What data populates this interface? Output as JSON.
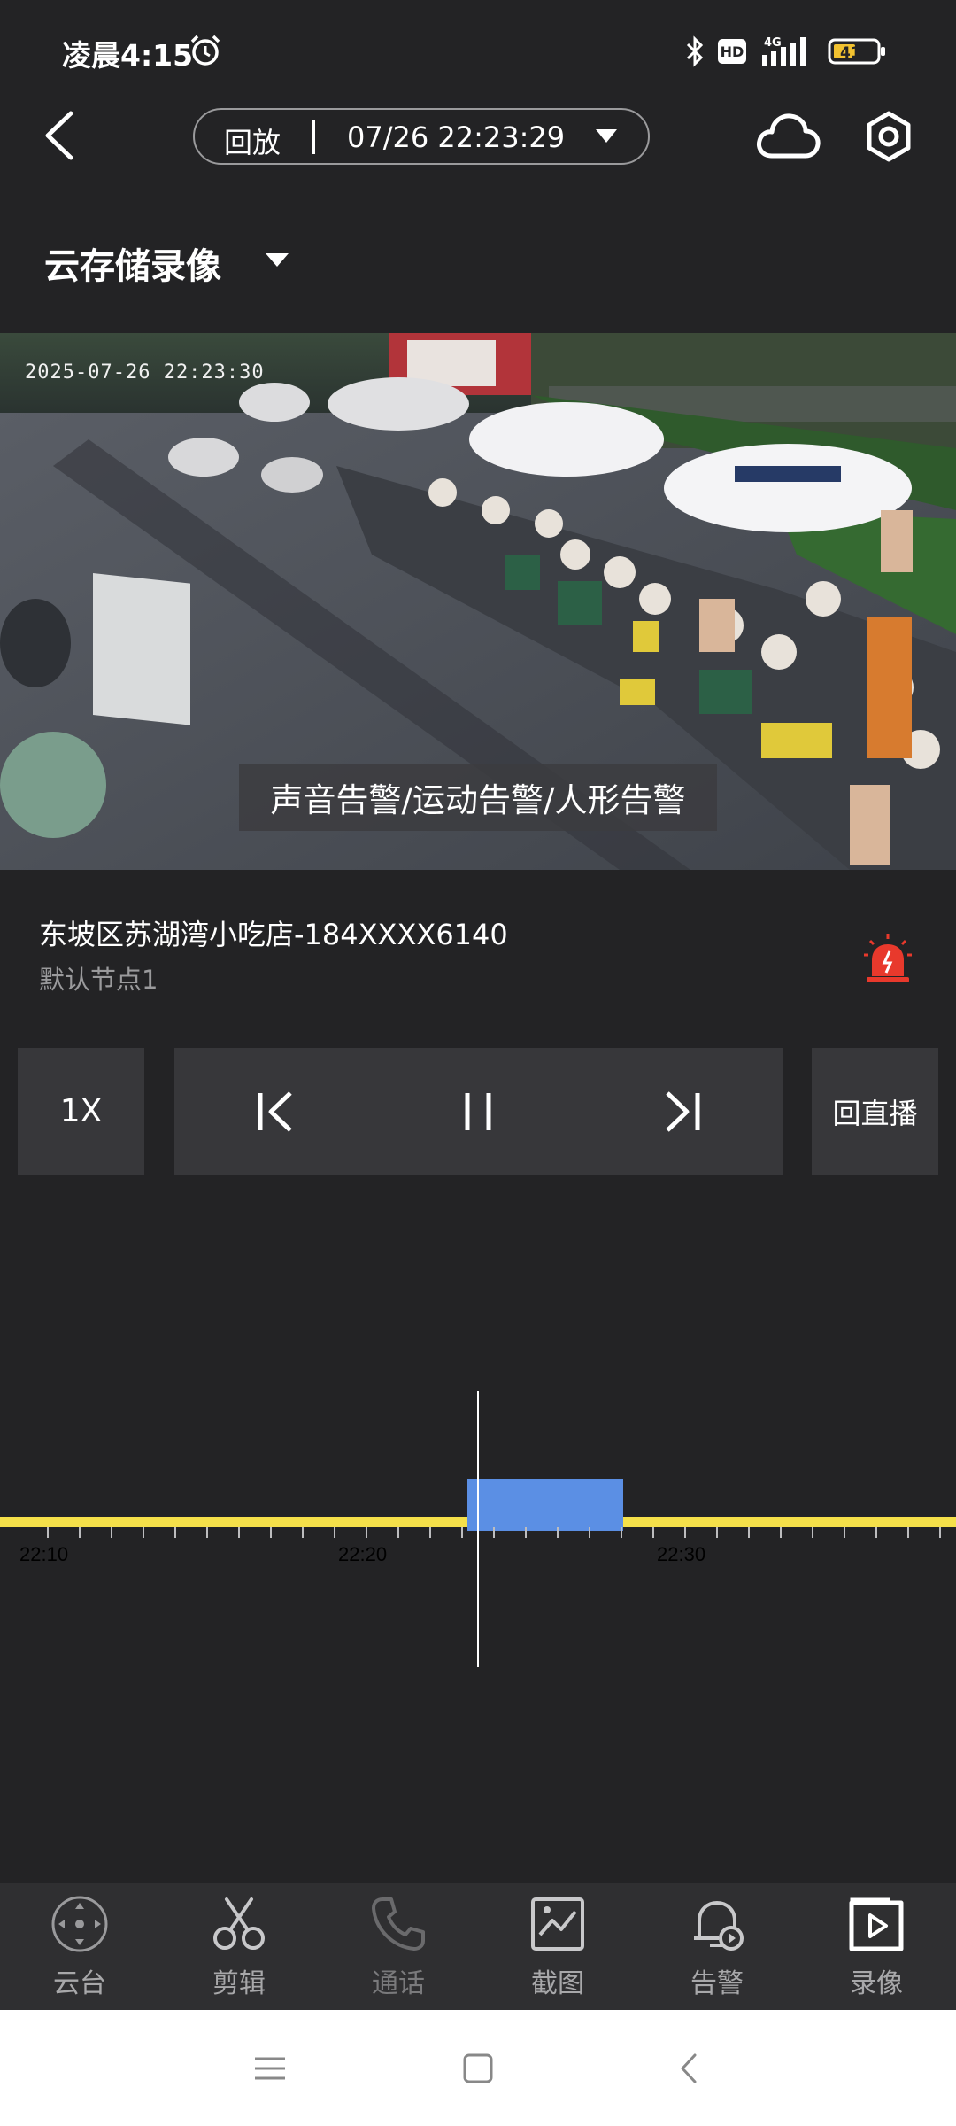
{
  "status_bar": {
    "time": "凌晨4:15",
    "hd_label": "HD",
    "network_label": "4G",
    "battery_level": "41"
  },
  "header": {
    "mode_label": "回放",
    "datetime": "07/26 22:23:29"
  },
  "storage": {
    "selected": "云存储录像"
  },
  "video": {
    "timestamp_overlay": "2025-07-26 22:23:30",
    "alert_text": "声音告警/运动告警/人形告警"
  },
  "device": {
    "name": "东坡区苏湖湾小吃店-184XXXX6140",
    "node": "默认节点1"
  },
  "controls": {
    "speed_label": "1X",
    "live_label": "回直播"
  },
  "timeline": {
    "tick_labels": [
      "22:10",
      "22:20",
      "22:30"
    ],
    "track_color": "#f5e04a",
    "recording_color": "#5b8fe4",
    "cursor_time": "22:23:29"
  },
  "bottom_nav": {
    "items": [
      {
        "label": "云台",
        "icon": "ptz-icon"
      },
      {
        "label": "剪辑",
        "icon": "scissors-icon"
      },
      {
        "label": "通话",
        "icon": "phone-icon"
      },
      {
        "label": "截图",
        "icon": "screenshot-icon"
      },
      {
        "label": "告警",
        "icon": "alarm-bell-icon"
      },
      {
        "label": "录像",
        "icon": "record-video-icon"
      }
    ]
  },
  "colors": {
    "background": "#232325",
    "siren_red": "#e8392c",
    "control_box": "#37373a"
  }
}
